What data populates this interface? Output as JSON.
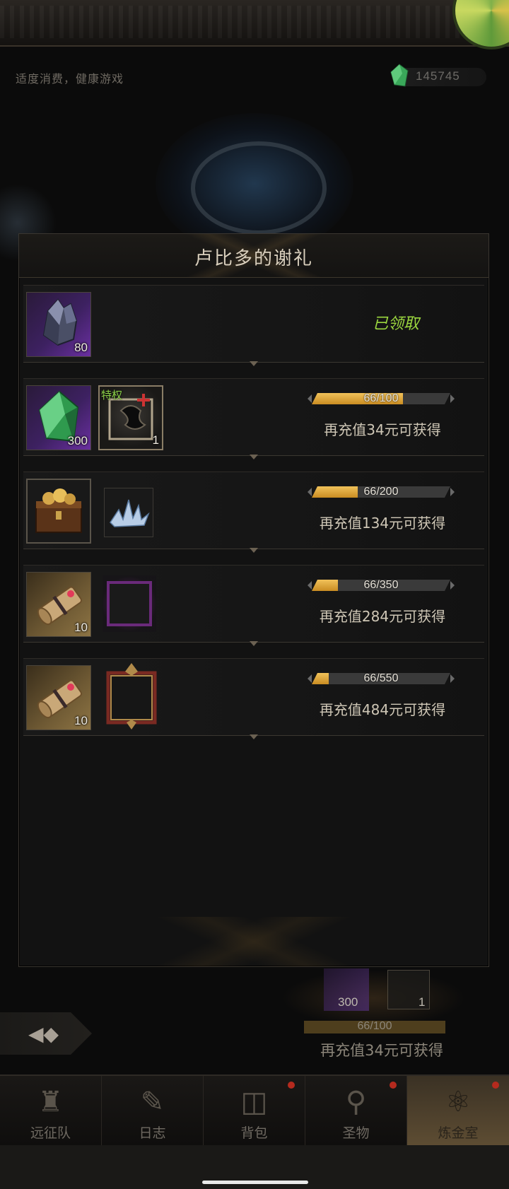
{
  "header": {
    "notice": "适度消费，健康游戏",
    "currency_value": "145745"
  },
  "modal": {
    "title": "卢比多的谢礼",
    "tiers": [
      {
        "items": [
          {
            "icon": "dark-crystal-icon",
            "qty": "80"
          }
        ],
        "status": "已领取"
      },
      {
        "items": [
          {
            "icon": "green-gem-icon",
            "qty": "300"
          },
          {
            "icon": "privilege-frame-icon",
            "qty": "1",
            "tag": "特权"
          }
        ],
        "progress_text": "66/100",
        "progress": 0.66,
        "recharge_text": "再充值34元可获得"
      },
      {
        "items": [
          {
            "icon": "treasure-chest-icon"
          },
          {
            "icon": "ice-crystal-icon"
          }
        ],
        "progress_text": "66/200",
        "progress": 0.33,
        "recharge_text": "再充值134元可获得"
      },
      {
        "items": [
          {
            "icon": "scroll-icon",
            "qty": "10"
          },
          {
            "icon": "purple-frame-icon"
          }
        ],
        "progress_text": "66/350",
        "progress": 0.19,
        "recharge_text": "再充值284元可获得"
      },
      {
        "items": [
          {
            "icon": "scroll-icon",
            "qty": "10"
          },
          {
            "icon": "ornate-frame-icon"
          }
        ],
        "progress_text": "66/550",
        "progress": 0.12,
        "recharge_text": "再充值484元可获得"
      }
    ]
  },
  "underlying": {
    "qty_gem": "300",
    "qty_frame": "1",
    "progress_text": "66/100",
    "recharge_text": "再充值34元可获得"
  },
  "nav": [
    {
      "label": "远征队",
      "icon": "horned-helmet-icon",
      "badge": false,
      "active": false
    },
    {
      "label": "日志",
      "icon": "journal-icon",
      "badge": false,
      "active": false
    },
    {
      "label": "背包",
      "icon": "backpack-icon",
      "badge": true,
      "active": false
    },
    {
      "label": "圣物",
      "icon": "chalice-icon",
      "badge": true,
      "active": false
    },
    {
      "label": "炼金室",
      "icon": "alchemy-icon",
      "badge": true,
      "active": true
    }
  ],
  "colors": {
    "accent_gold": "#e0a83a",
    "claimed_green": "#9bd73f",
    "badge_red": "#b52a1e"
  }
}
